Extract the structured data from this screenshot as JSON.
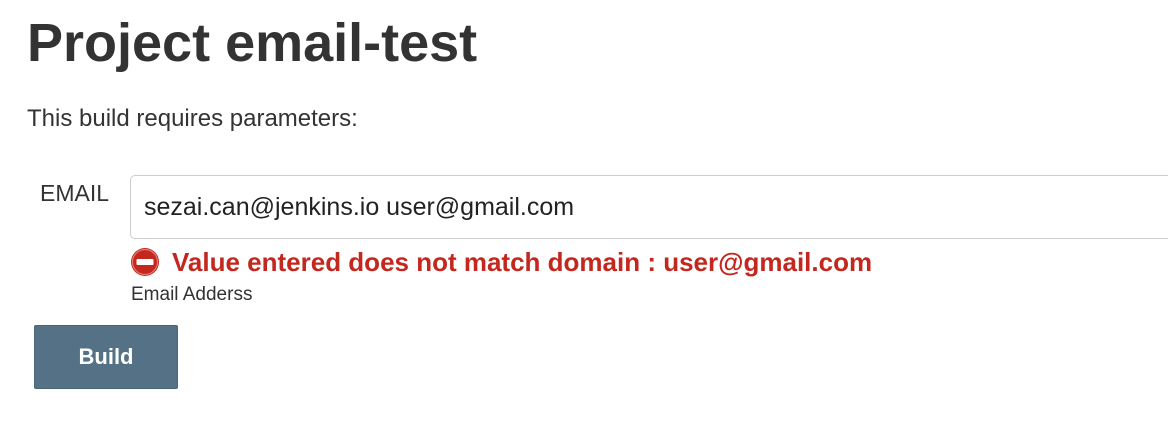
{
  "page": {
    "title": "Project email-test",
    "intro": "This build requires parameters:"
  },
  "parameter": {
    "label": "EMAIL",
    "value": "sezai.can@jenkins.io user@gmail.com",
    "error_icon": "error-icon",
    "error_message": "Value entered does not match domain : user@gmail.com",
    "description": "Email Adderss"
  },
  "actions": {
    "build_label": "Build"
  },
  "colors": {
    "error": "#c4271e",
    "button": "#557186",
    "text": "#333333"
  }
}
